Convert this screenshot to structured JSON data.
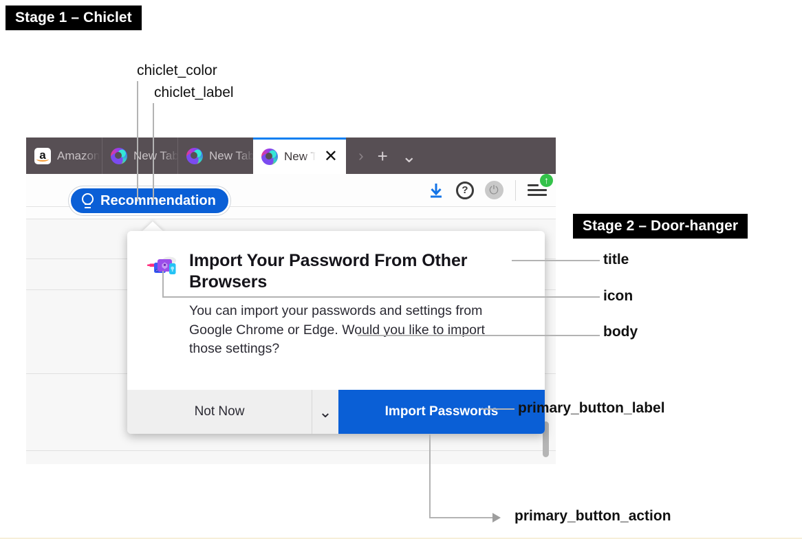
{
  "stages": {
    "stage1": "Stage 1 – Chiclet",
    "stage2": "Stage 2 – Door-hanger"
  },
  "annotations": {
    "chiclet_color": "chiclet_color",
    "chiclet_label": "chiclet_label",
    "title": "title",
    "icon": "icon",
    "body": "body",
    "primary_button_label": "primary_button_label",
    "primary_button_action": "primary_button_action"
  },
  "browser": {
    "tabs": [
      {
        "favicon": "amazon-icon",
        "label": "Amazon",
        "active": false
      },
      {
        "favicon": "firefox-icon",
        "label": "New Tab",
        "active": false
      },
      {
        "favicon": "firefox-icon",
        "label": "New Tab",
        "active": false
      },
      {
        "favicon": "firefox-icon",
        "label": "New Tab",
        "active": true,
        "close": "✕"
      }
    ],
    "tab_controls": {
      "scroll_right": "›",
      "new_tab": "+",
      "list_all_tabs": "⌄"
    },
    "toolbar_icons": [
      {
        "name": "downloads-icon"
      },
      {
        "name": "info-icon",
        "glyph": "?"
      },
      {
        "name": "power-sync-icon",
        "glyph": "⏻"
      },
      {
        "name": "app-menu-icon",
        "badge": "↑"
      }
    ]
  },
  "chiclet": {
    "icon": "lightbulb-icon",
    "label": "Recommendation",
    "color": "#0a5fd6"
  },
  "doorhanger": {
    "icon": "import-passwords-icon",
    "title": "Import Your Password From Other Browsers",
    "body": "You can import your passwords and settings from Google Chrome or Edge. Would you like to import those settings?",
    "secondary_button_label": "Not Now",
    "dropdown_glyph": "⌄",
    "primary_button_label": "Import Passwords",
    "primary_button_color": "#0a5fd6"
  }
}
